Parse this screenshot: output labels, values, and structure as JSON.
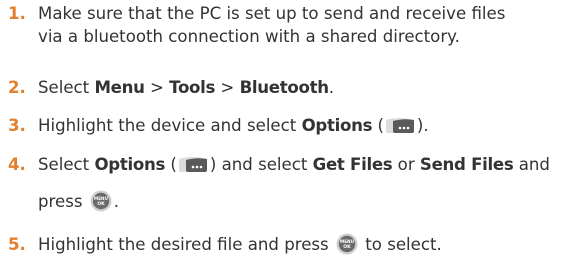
{
  "steps": [
    {
      "number": "1.",
      "line1": "Make sure that the PC is set up to send and receive files",
      "line2": "via a bluetooth connection with a shared directory."
    },
    {
      "number": "2.",
      "text_select": "Select ",
      "menu": "Menu",
      "sep1": " > ",
      "tools": "Tools",
      "sep2": " > ",
      "bluetooth": "Bluetooth",
      "end": "."
    },
    {
      "number": "3.",
      "text_before": "Highlight the device and select ",
      "options": "Options",
      "paren_open": " (",
      "paren_close": ")."
    },
    {
      "number": "4.",
      "text_select": "Select ",
      "options": "Options",
      "paren_open": " (",
      "paren_close": ") and select ",
      "get_files": "Get Files",
      "or": " or ",
      "send_files": "Send Files",
      "and": " and",
      "line2": "press ",
      "line2_end": "."
    },
    {
      "number": "5.",
      "text_before": "Highlight the desired file and press ",
      "text_after": " to select."
    }
  ],
  "icons": {
    "options_softkey": "options-softkey-icon",
    "menu_ok_key": "menu-ok-key-icon",
    "menu_ok_key_text_top": "MENU",
    "menu_ok_key_text_bottom": "OK"
  },
  "colors": {
    "text": "#333333",
    "number": "#e3802d",
    "icon_dark": "#555555",
    "icon_light": "#cfcfcf"
  }
}
